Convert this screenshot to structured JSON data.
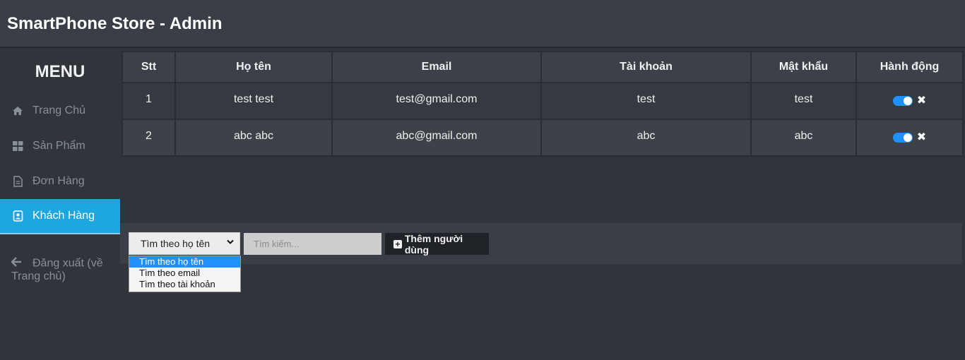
{
  "header": {
    "title": "SmartPhone Store - Admin"
  },
  "sidebar": {
    "menu_title": "MENU",
    "items": [
      {
        "label": "Trang Chủ",
        "icon": "home-icon"
      },
      {
        "label": "Sản Phẩm",
        "icon": "grid-icon"
      },
      {
        "label": "Đơn Hàng",
        "icon": "document-icon"
      },
      {
        "label": "Khách Hàng",
        "icon": "contact-icon",
        "active": true
      }
    ],
    "logout": {
      "label": "Đăng xuất (về Trang chủ)",
      "icon": "arrow-left-icon"
    }
  },
  "table": {
    "headers": [
      "Stt",
      "Họ tên",
      "Email",
      "Tài khoản",
      "Mật khẩu",
      "Hành động"
    ],
    "rows": [
      {
        "stt": "1",
        "name": "test test",
        "email": "test@gmail.com",
        "account": "test",
        "password": "test",
        "enabled": true
      },
      {
        "stt": "2",
        "name": "abc abc",
        "email": "abc@gmail.com",
        "account": "abc",
        "password": "abc",
        "enabled": true
      }
    ]
  },
  "toolbar": {
    "search_by_selected": "Tìm theo họ tên",
    "search_placeholder": "Tìm kiếm...",
    "add_user_label": "Thêm người dùng",
    "search_options": [
      "Tìm theo họ tên",
      "Tìm theo email",
      "Tìm theo tài khoản"
    ]
  },
  "colors": {
    "accent": "#1ea7df",
    "background": "#30343b",
    "toggle_on": "#1e90ff"
  }
}
